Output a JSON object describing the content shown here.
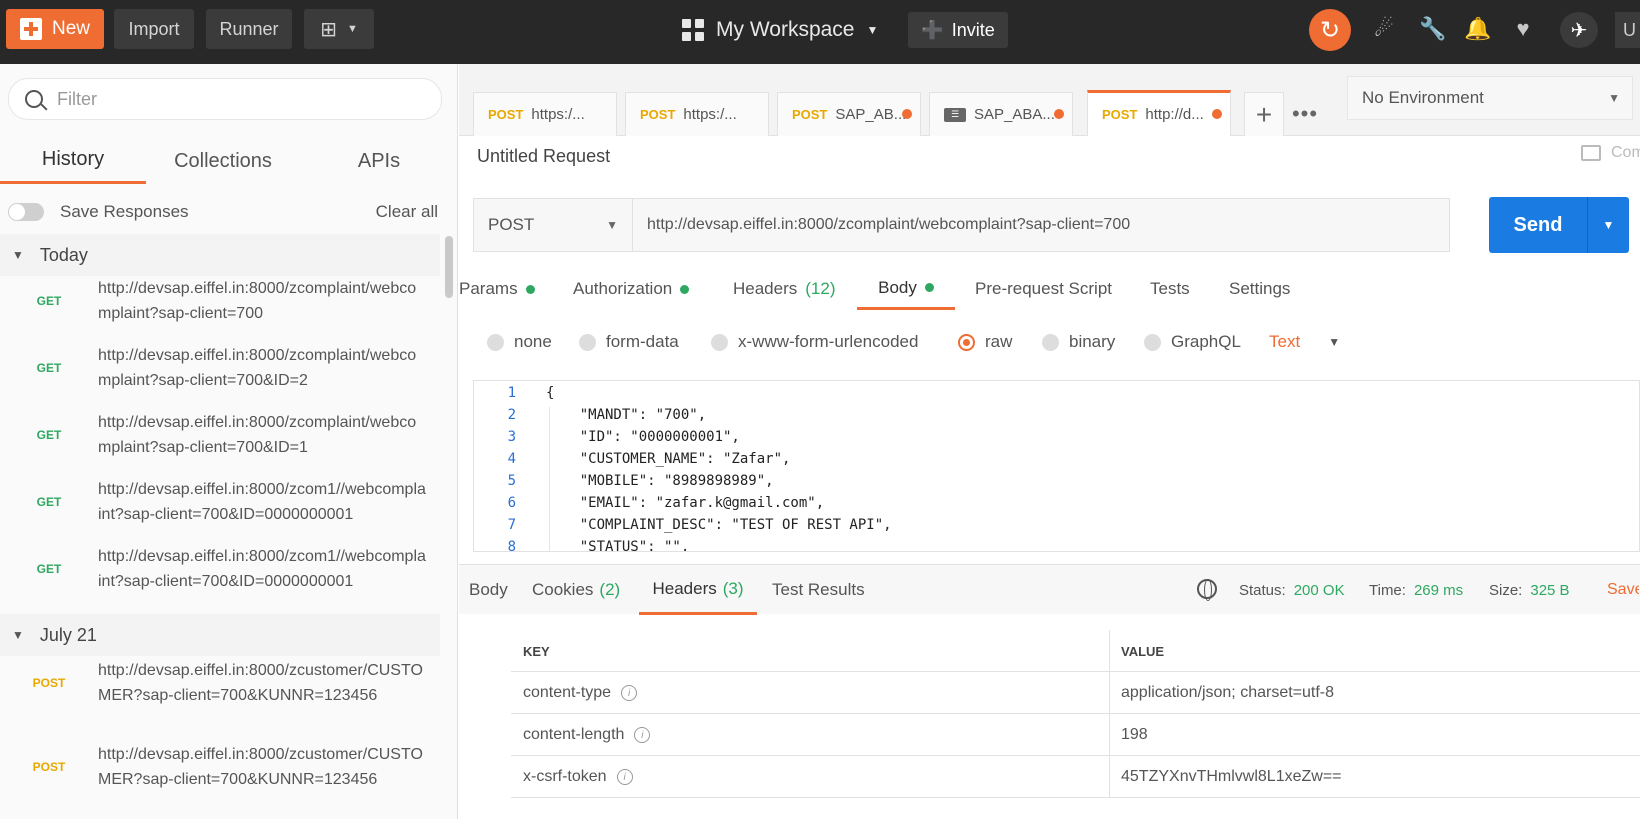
{
  "topbar": {
    "new_label": "New",
    "import_label": "Import",
    "runner_label": "Runner",
    "workspace_label": "My Workspace",
    "invite_label": "Invite",
    "user_initial": "U",
    "accent_color": "#ef6c33"
  },
  "sidebar": {
    "filter_placeholder": "Filter",
    "tabs": [
      "History",
      "Collections",
      "APIs"
    ],
    "active_tab": "History",
    "save_responses_label": "Save Responses",
    "clear_all_label": "Clear all",
    "groups": [
      {
        "label": "Today",
        "items": [
          {
            "method": "GET",
            "url": "http://devsap.eiffel.in:8000/zcomplaint/webcomplaint?sap-client=700"
          },
          {
            "method": "GET",
            "url": "http://devsap.eiffel.in:8000/zcomplaint/webcomplaint?sap-client=700&ID=2"
          },
          {
            "method": "GET",
            "url": "http://devsap.eiffel.in:8000/zcomplaint/webcomplaint?sap-client=700&ID=1"
          },
          {
            "method": "GET",
            "url": "http://devsap.eiffel.in:8000/zcom1//webcomplaint?sap-client=700&ID=0000000001"
          },
          {
            "method": "GET",
            "url": "http://devsap.eiffel.in:8000/zcom1//webcomplaint?sap-client=700&ID=0000000001"
          }
        ]
      },
      {
        "label": "July 21",
        "items": [
          {
            "method": "POST",
            "url": "http://devsap.eiffel.in:8000/zcustomer/CUSTOMER?sap-client=700&KUNNR=123456"
          },
          {
            "method": "POST",
            "url": "http://devsap.eiffel.in:8000/zcustomer/CUSTOMER?sap-client=700&KUNNR=123456"
          }
        ]
      }
    ]
  },
  "request_tabs": [
    {
      "method": "POST",
      "label": "https:/...",
      "dot": false,
      "active": false
    },
    {
      "method": "POST",
      "label": "https:/...",
      "dot": false,
      "active": false
    },
    {
      "method": "POST",
      "label": "SAP_AB...",
      "dot": true,
      "active": false
    },
    {
      "method": "",
      "label": "SAP_ABA...",
      "dot": true,
      "active": false,
      "icon": "environment-icon"
    },
    {
      "method": "POST",
      "label": "http://d...",
      "dot": true,
      "active": true
    }
  ],
  "environment": {
    "selected": "No Environment"
  },
  "request": {
    "title": "Untitled Request",
    "comments_label": "Comments",
    "method": "POST",
    "url": "http://devsap.eiffel.in:8000/zcomplaint/webcomplaint?sap-client=700",
    "send_label": "Send"
  },
  "request_subtabs": [
    {
      "label": "Params",
      "dot": true
    },
    {
      "label": "Authorization",
      "dot": true
    },
    {
      "label": "Headers",
      "count": "(12)"
    },
    {
      "label": "Body",
      "dot": true,
      "active": true
    },
    {
      "label": "Pre-request Script"
    },
    {
      "label": "Tests"
    },
    {
      "label": "Settings"
    }
  ],
  "body_options": {
    "types": [
      "none",
      "form-data",
      "x-www-form-urlencoded",
      "raw",
      "binary",
      "GraphQL"
    ],
    "selected": "raw",
    "format": "Text"
  },
  "editor": {
    "lines": [
      {
        "n": "1",
        "text": "{"
      },
      {
        "n": "2",
        "text": "    \"MANDT\": \"700\","
      },
      {
        "n": "3",
        "text": "    \"ID\": \"0000000001\","
      },
      {
        "n": "4",
        "text": "    \"CUSTOMER_NAME\": \"Zafar\","
      },
      {
        "n": "5",
        "text": "    \"MOBILE\": \"8989898989\","
      },
      {
        "n": "6",
        "text": "    \"EMAIL\": \"zafar.k@gmail.com\","
      },
      {
        "n": "7",
        "text": "    \"COMPLAINT_DESC\": \"TEST OF REST API\","
      },
      {
        "n": "8",
        "text": "    \"STATUS\": \"\","
      }
    ]
  },
  "response": {
    "tabs": [
      {
        "label": "Body"
      },
      {
        "label": "Cookies",
        "count": "(2)"
      },
      {
        "label": "Headers",
        "count": "(3)",
        "active": true
      },
      {
        "label": "Test Results"
      }
    ],
    "status_label": "Status:",
    "status_value": "200 OK",
    "time_label": "Time:",
    "time_value": "269 ms",
    "size_label": "Size:",
    "size_value": "325 B",
    "save_label": "Save",
    "headers_table": {
      "columns": [
        "KEY",
        "VALUE"
      ],
      "rows": [
        {
          "key": "content-type",
          "value": "application/json; charset=utf-8"
        },
        {
          "key": "content-length",
          "value": "198"
        },
        {
          "key": "x-csrf-token",
          "value": "45TZYXnvTHmlvwl8L1xeZw=="
        }
      ]
    }
  }
}
